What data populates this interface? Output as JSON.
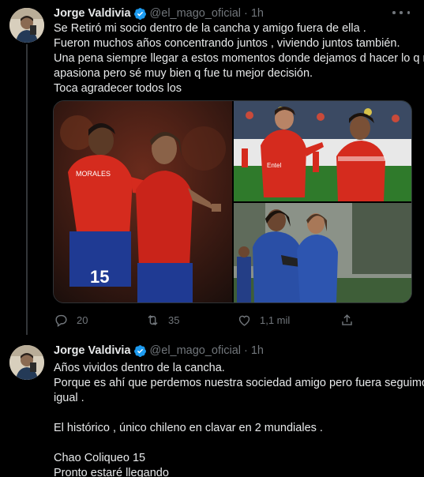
{
  "tweets": [
    {
      "author_name": "Jorge Valdivia",
      "handle": "@el_mago_oficial",
      "time": "1h",
      "lines": [
        "Se Retiró mi socio dentro de la cancha y amigo fuera de ella .",
        "Fueron muchos años concentrando juntos , viviendo juntos también.",
        "Una pena siempre llegar a estos momentos donde dejamos d hacer lo q nos",
        "apasiona pero sé muy bien q fue tu mejor decisión.",
        "Toca agradecer todos los"
      ],
      "actions": {
        "reply_count": "20",
        "retweet_count": "35",
        "like_count": "1,1 mil"
      }
    },
    {
      "author_name": "Jorge Valdivia",
      "handle": "@el_mago_oficial",
      "time": "1h",
      "lines": [
        "Años vividos dentro de la cancha.",
        "Porque es ahí que perdemos nuestra sociedad amigo pero  fuera seguimos",
        "igual .",
        "",
        "El histórico , único chileno en clavar en 2 mundiales .",
        "",
        "Chao Coliqueo 15",
        "Pronto estaré llegando"
      ]
    }
  ],
  "photo_texts": {
    "jersey_name": "MORALES",
    "jersey_number": "15",
    "shirt_sponsor": "Entel"
  },
  "colors": {
    "background": "#000000",
    "text_primary": "#e7e9ea",
    "text_secondary": "#71767b",
    "verified": "#1d9bf0",
    "chile_red": "#d52b1e",
    "chile_blue": "#1f3a93"
  },
  "icons": [
    "more-icon",
    "verified-icon",
    "reply-icon",
    "retweet-icon",
    "like-icon",
    "share-icon"
  ]
}
